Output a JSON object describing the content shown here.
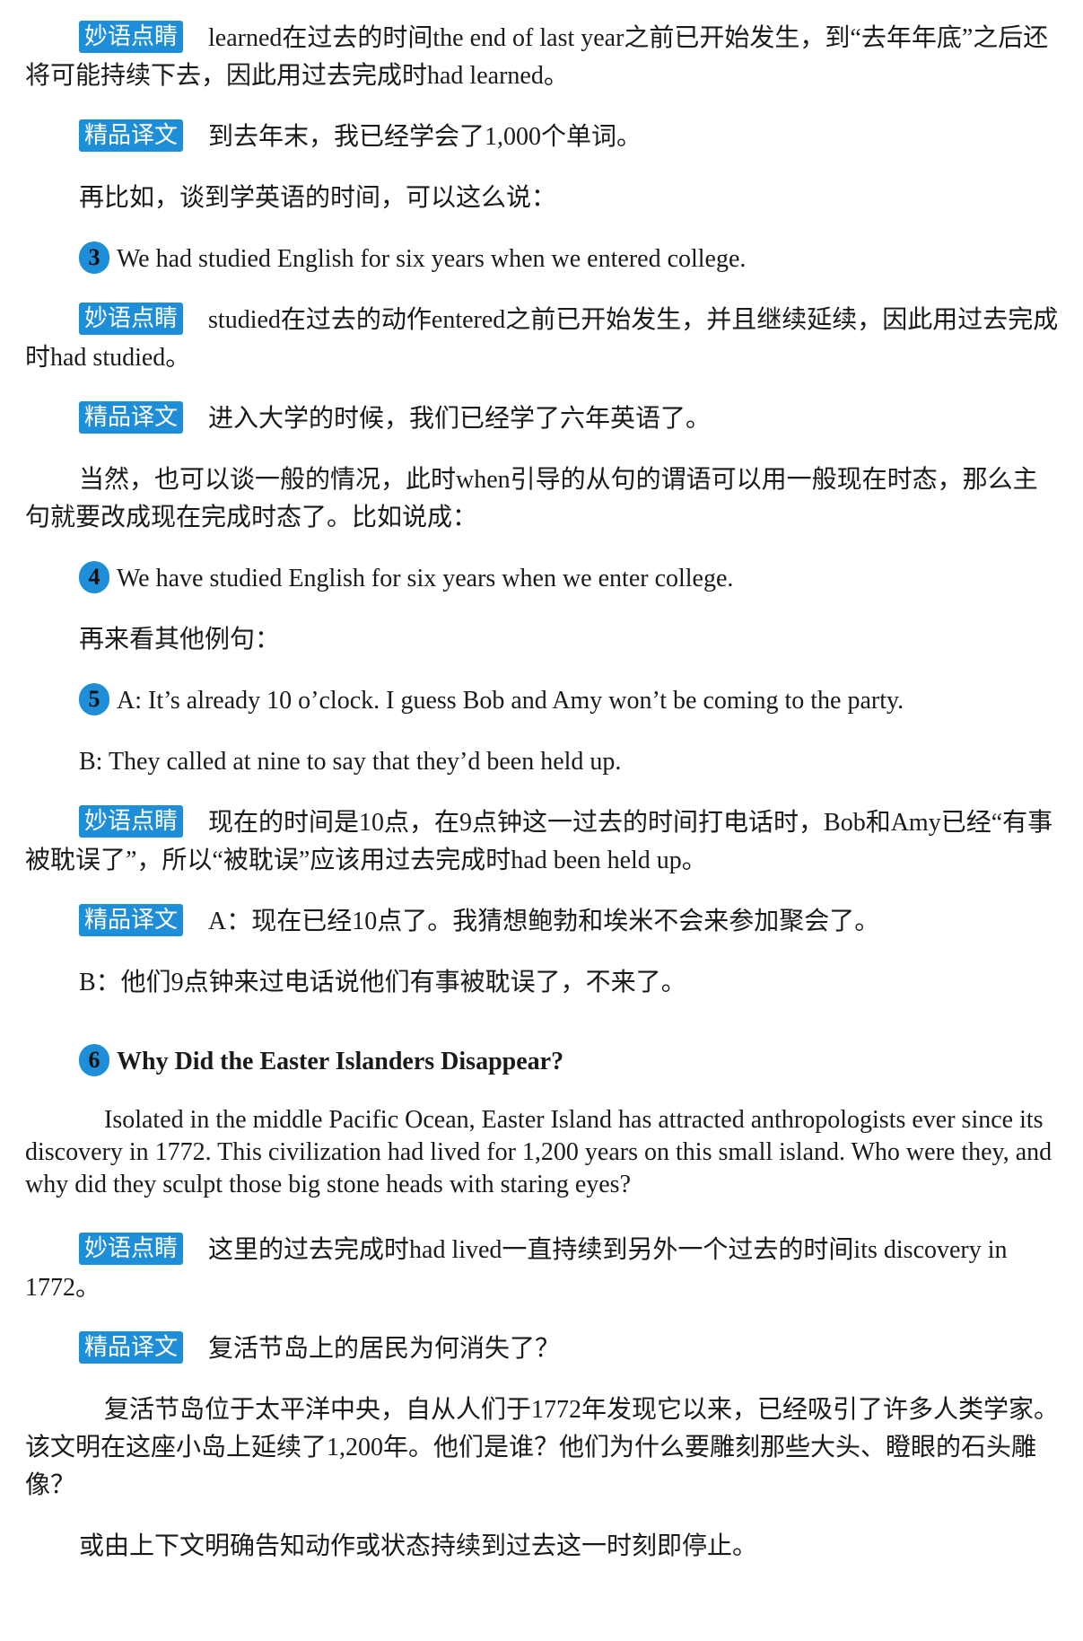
{
  "tags": {
    "comment": "妙语点睛",
    "translation": "精品译文"
  },
  "blocks": {
    "b1_comment": "learned在过去的时间the end of last year之前已开始发生，到“去年年底”之后还将可能持续下去，因此用过去完成时had learned。",
    "b2_translation": "到去年末，我已经学会了1,000个单词。",
    "b3_text": "再比如，谈到学英语的时间，可以这么说：",
    "ex3_num": "3",
    "ex3_text": "We had studied English for six years when we entered college.",
    "b4_comment": "studied在过去的动作entered之前已开始发生，并且继续延续，因此用过去完成时had studied。",
    "b5_translation": "进入大学的时候，我们已经学了六年英语了。",
    "b6_text": "当然，也可以谈一般的情况，此时when引导的从句的谓语可以用一般现在时态，那么主句就要改成现在完成时态了。比如说成：",
    "ex4_num": "4",
    "ex4_text": "We have studied English for six years when we enter college.",
    "b7_text": "再来看其他例句：",
    "ex5_num": "5",
    "ex5_text": "A: It’s already 10 o’clock. I guess Bob and Amy won’t be coming to the party.",
    "ex5_b": "B: They called at nine to say that they’d been held up.",
    "b8_comment": "现在的时间是10点，在9点钟这一过去的时间打电话时，Bob和Amy已经“有事被耽误了”，所以“被耽误”应该用过去完成时had been held up。",
    "b9_translation": "A：现在已经10点了。我猜想鲍勃和埃米不会来参加聚会了。",
    "b9_b": "B：他们9点钟来过电话说他们有事被耽误了，不来了。",
    "ex6_num": "6",
    "ex6_title": "Why Did the Easter Islanders Disappear?",
    "ex6_para": "Isolated in the middle Pacific Ocean, Easter Island has attracted anthropologists ever since its discovery in 1772. This civilization had lived for 1,200 years on this small island. Who were they, and why did they sculpt those big stone heads with staring eyes?",
    "b10_comment": "这里的过去完成时had lived一直持续到另外一个过去的时间its discovery in 1772。",
    "b11_translation": "复活节岛上的居民为何消失了？",
    "b11_para": "复活节岛位于太平洋中央，自从人们于1772年发现它以来，已经吸引了许多人类学家。该文明在这座小岛上延续了1,200年。他们是谁？他们为什么要雕刻那些大头、瞪眼的石头雕像？",
    "b12_text": "或由上下文明确告知动作或状态持续到过去这一时刻即停止。"
  }
}
